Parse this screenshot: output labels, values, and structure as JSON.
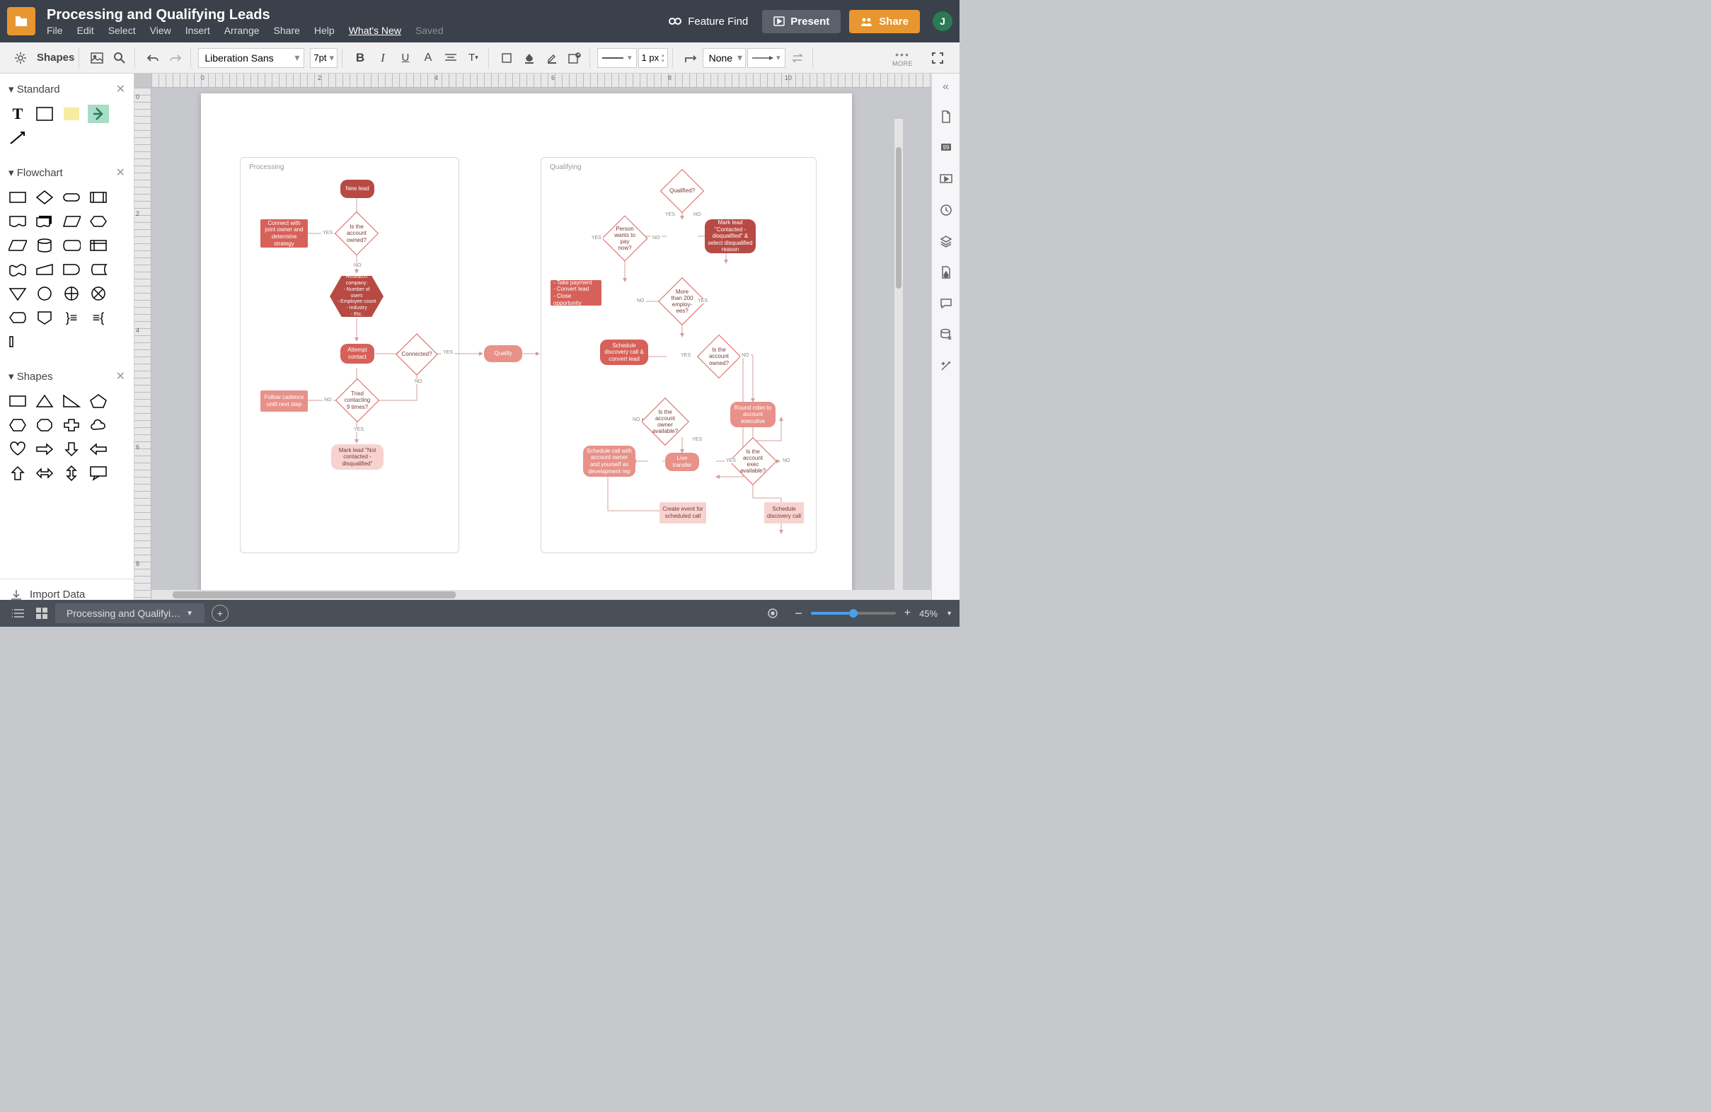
{
  "header": {
    "doc_title": "Processing and Qualifying Leads",
    "menu": [
      "File",
      "Edit",
      "Select",
      "View",
      "Insert",
      "Arrange",
      "Share",
      "Help",
      "What's New"
    ],
    "saved": "Saved",
    "feature_find": "Feature Find",
    "present": "Present",
    "share": "Share",
    "avatar": "J"
  },
  "toolbar": {
    "shapes_label": "Shapes",
    "font": "Liberation Sans",
    "font_size": "7pt",
    "line_width": "1 px",
    "fill": "None",
    "more": "MORE"
  },
  "left_panel": {
    "sections": {
      "standard": "Standard",
      "flowchart": "Flowchart",
      "shapes": "Shapes"
    },
    "import": "Import Data"
  },
  "ruler_marks": {
    "h": [
      "0",
      "2",
      "4",
      "6",
      "8",
      "10"
    ],
    "v": [
      "0",
      "2",
      "4",
      "6",
      "8"
    ]
  },
  "flowchart": {
    "containers": {
      "processing": "Processing",
      "qualifying": "Qualifying"
    },
    "processing_nodes": {
      "new_lead": "New lead",
      "is_owned": "Is the account owned?",
      "connect_owner": "Connect with joint owner and determine strategy",
      "research": "Research company:\n- Number of users\n- Employee count\n- Industry\n- Etc.",
      "attempt": "Attempt contact",
      "connected": "Connected?",
      "qualify": "Qualify",
      "tried9": "Tried contacting 9 times?",
      "cadence": "Follow cadence until next step",
      "not_contacted": "Mark lead \"Not contacted - disqualified\""
    },
    "qualifying_nodes": {
      "qualified": "Qualified?",
      "pay_now": "Person wants to pay now?",
      "mark_disq": "Mark lead \"Contacted - disqualified\" & select disqualified reason",
      "take_payment": "- Take payment\n- Convert lead\n- Close opportunity",
      "over200": "More than 200 employ-ees?",
      "schedule_discovery": "Schedule discovery call & convert lead",
      "is_owned2": "Is the account owned?",
      "owner_avail": "Is the account owner available?",
      "round_robin": "Round robin to account executive",
      "sched_call_owner": "Schedule call with account owner and yourself as development rep",
      "live_transfer": "Live transfer",
      "exec_avail": "Is the account exec available?",
      "create_event": "Create event for scheduled call",
      "sched_disc2": "Schedule discovery call"
    },
    "labels": {
      "yes": "YES",
      "no": "NO"
    }
  },
  "bottombar": {
    "tab": "Processing and Qualifyi…",
    "zoom": "45%"
  }
}
